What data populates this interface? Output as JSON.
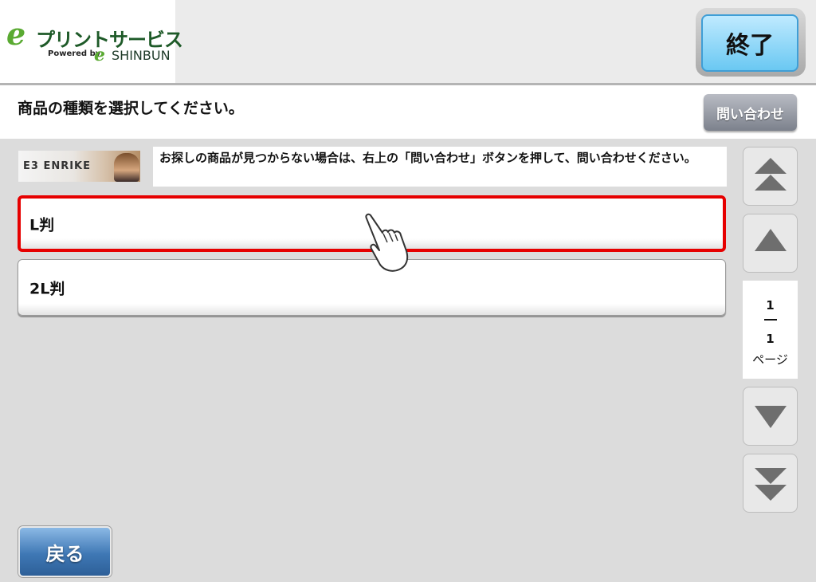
{
  "header": {
    "logo": {
      "mark": "e",
      "title": "プリントサービス",
      "powered_by": "Powered by",
      "mark2": "e",
      "brand": "SHINBUN"
    },
    "end_button_label": "終了"
  },
  "instruction": {
    "text": "商品の種類を選択してください。",
    "inquiry_button_label": "問い合わせ"
  },
  "banner": {
    "logo_text": "E3 ENRIKE"
  },
  "notice": {
    "text": "お探しの商品が見つからない場合は、右上の「問い合わせ」ボタンを押して、問い合わせください。"
  },
  "product_list": {
    "items": [
      {
        "label": "L判",
        "selected": true
      },
      {
        "label": "2L判",
        "selected": false
      }
    ]
  },
  "pager": {
    "current_page": "1",
    "total_pages": "1",
    "page_word": "ページ",
    "icons": [
      "double-up-icon",
      "up-icon",
      "down-icon",
      "double-down-icon"
    ]
  },
  "footer": {
    "back_button_label": "戻る"
  },
  "colors": {
    "selected_border": "#e60000",
    "end_button": "#6ac8f2",
    "back_button": "#3f78b5",
    "logo_green": "#5aaa32"
  }
}
